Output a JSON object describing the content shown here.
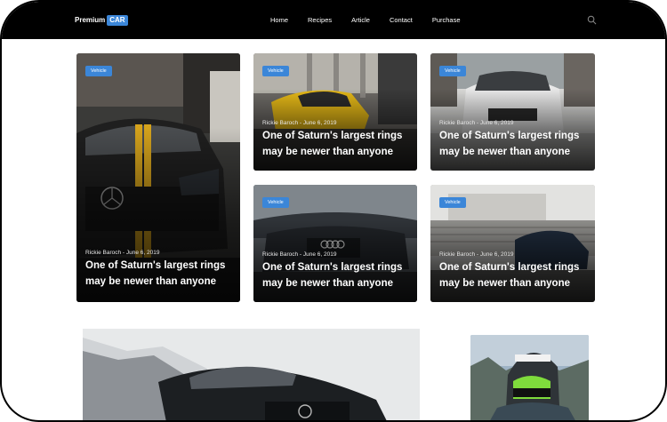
{
  "header": {
    "logo_text": "Premium",
    "logo_badge": "CAR",
    "nav": [
      "Home",
      "Recipes",
      "Article",
      "Contact",
      "Purchase"
    ]
  },
  "cards": [
    {
      "tag": "Vehicle",
      "meta": "Rickie Baroch - June 6, 2019",
      "title_line1": "One of Saturn's largest rings",
      "title_line2": "may be newer than anyone"
    },
    {
      "tag": "Vehicle",
      "meta": "Rickie Baroch - June 6, 2019",
      "title_line1": "One of Saturn's largest rings",
      "title_line2": "may be newer than anyone"
    },
    {
      "tag": "Vehicle",
      "meta": "Rickie Baroch - June 6, 2019",
      "title_line1": "One of Saturn's largest rings",
      "title_line2": "may be newer than anyone"
    },
    {
      "tag": "Vehicle",
      "meta": "Rickie Baroch - June 6, 2019",
      "title_line1": "One of Saturn's largest rings",
      "title_line2": "may be newer than anyone"
    },
    {
      "tag": "Vehicle",
      "meta": "Rickie Baroch - June 6, 2019",
      "title_line1": "One of Saturn's largest rings",
      "title_line2": "may be newer than anyone"
    }
  ],
  "colors": {
    "accent": "#3b86d8",
    "header_bg": "#000000"
  },
  "icons": {
    "search": "search-icon"
  }
}
